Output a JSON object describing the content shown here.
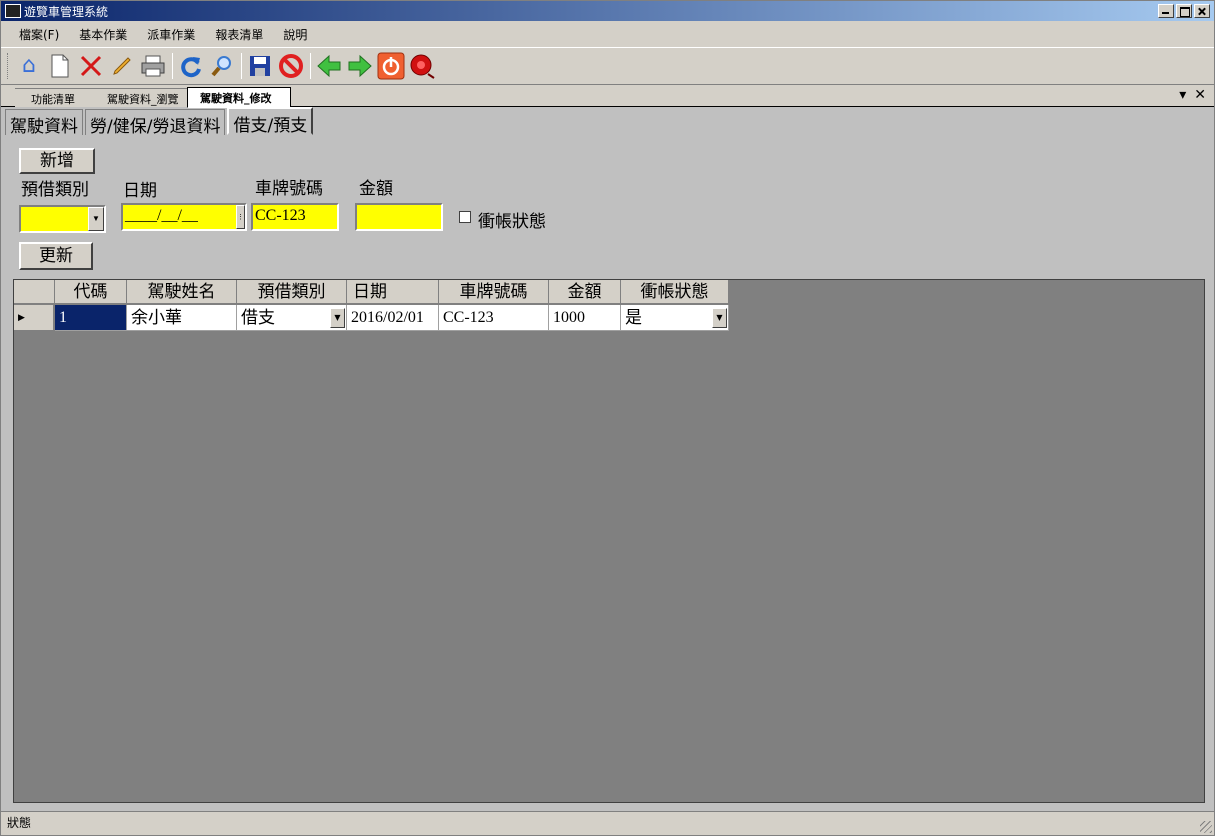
{
  "window": {
    "title": "遊覽車管理系統"
  },
  "menu": [
    "檔案(F)",
    "基本作業",
    "派車作業",
    "報表清單",
    "說明"
  ],
  "toolbar": {
    "icons": [
      {
        "name": "home-icon",
        "glyph": "🏠",
        "color": "#3a6fd8"
      },
      {
        "name": "new-document-icon",
        "glyph": "🗋",
        "color": "#ffffff"
      },
      {
        "name": "delete-icon",
        "glyph": "✕",
        "color": "#d41818"
      },
      {
        "name": "edit-pencil-icon",
        "glyph": "✎",
        "color": "#e0a020"
      },
      {
        "name": "print-icon",
        "glyph": "⎙",
        "color": "#505050"
      },
      {
        "name": "refresh-icon",
        "glyph": "↻",
        "color": "#1e64c8"
      },
      {
        "name": "search-icon",
        "glyph": "🔍",
        "color": "#3a7ad0"
      },
      {
        "name": "save-icon",
        "glyph": "💾",
        "color": "#2040a0"
      },
      {
        "name": "cancel-icon",
        "glyph": "⊘",
        "color": "#e02020"
      },
      {
        "name": "back-arrow-icon",
        "glyph": "◀",
        "color": "#30b030"
      },
      {
        "name": "forward-arrow-icon",
        "glyph": "▶",
        "color": "#30b030"
      },
      {
        "name": "power-icon",
        "glyph": "⏻",
        "color": "#e05020"
      },
      {
        "name": "alarm-bell-icon",
        "glyph": "🔔",
        "color": "#c01010"
      }
    ]
  },
  "doc_tabs": [
    "功能清單",
    "駕駛資料_瀏覽",
    "駕駛資料_修改"
  ],
  "inner_tabs": [
    "駕駛資料",
    "勞/健保/勞退資料",
    "借支/預支"
  ],
  "form": {
    "add_label": "新增",
    "type_label": "預借類別",
    "date_label": "日期",
    "plate_label": "車牌號碼",
    "amount_label": "金額",
    "type_value": "",
    "date_mask": "____/__/__",
    "plate_value": "CC-123",
    "amount_value": "",
    "offset_label": "衝帳狀態",
    "update_label": "更新"
  },
  "grid": {
    "columns": [
      "代碼",
      "駕駛姓名",
      "預借類別",
      "日期",
      "車牌號碼",
      "金額",
      "衝帳狀態"
    ],
    "rows": [
      {
        "code": "1",
        "name": "余小華",
        "type": "借支",
        "date": "2016/02/01",
        "plate": "CC-123",
        "amount": "1000",
        "offset": "是"
      }
    ]
  },
  "status": "狀態"
}
